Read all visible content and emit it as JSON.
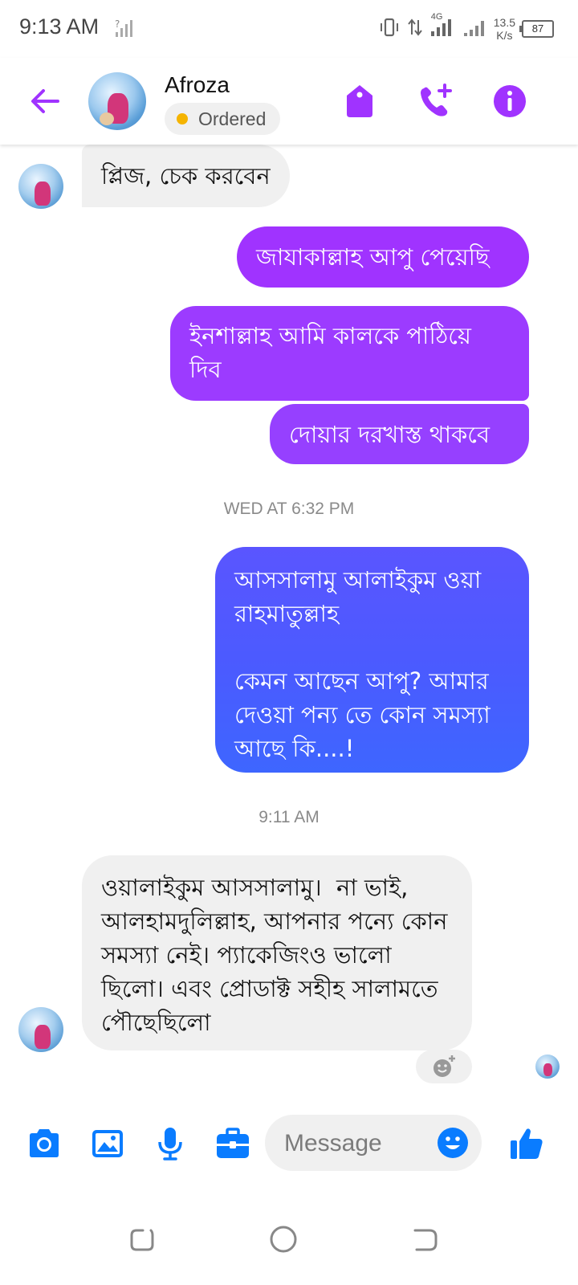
{
  "status_bar": {
    "time": "9:13 AM",
    "network_type": "4G",
    "net_speed_value": "13.5",
    "net_speed_unit": "K/s",
    "battery_level": "87"
  },
  "header": {
    "contact_name": "Afroza",
    "label": "Ordered",
    "label_color": "#f5b400",
    "accent_color": "#a033ff"
  },
  "messages": [
    {
      "direction": "incoming",
      "text": "প্লিজ, চেক করবেন"
    },
    {
      "direction": "outgoing",
      "text": "জাযাকাল্লাহ আপু পেয়েছি"
    },
    {
      "direction": "outgoing",
      "text": "ইনশাল্লাহ আমি কালকে পাঠিয়ে দিব"
    },
    {
      "direction": "outgoing",
      "text": "দোয়ার দরখাস্ত থাকবে"
    },
    {
      "direction": "outgoing",
      "text": "আসসালামু আলাইকুম ওয়া রাহমাতুল্লাহ\n\nকেমন আছেন আপু? আমার দেওয়া পন্য তে কোন সমস্যা আছে কি....!"
    },
    {
      "direction": "incoming",
      "text": "ওয়ালাইকুম আসসালামু।  না ভাই, আলহামদুলিল্লাহ, আপনার পন্যে কোন সমস্যা নেই। প্যাকেজিংও ভালো ছিলো। এবং প্রোডাক্ট সহীহ সালামতে পৌছেছিলো"
    }
  ],
  "timestamps": [
    "WED AT 6:32 PM",
    "9:11 AM"
  ],
  "composer": {
    "placeholder": "Message",
    "icons": [
      "camera-icon",
      "gallery-icon",
      "microphone-icon",
      "briefcase-icon",
      "emoji-icon",
      "thumbs-up-icon"
    ],
    "icon_color": "#0a7cff"
  },
  "bubble_colors": {
    "incoming": "#f0f0f0",
    "outgoing_top": "#a033ff",
    "outgoing_bottom": "#4b6bff"
  }
}
